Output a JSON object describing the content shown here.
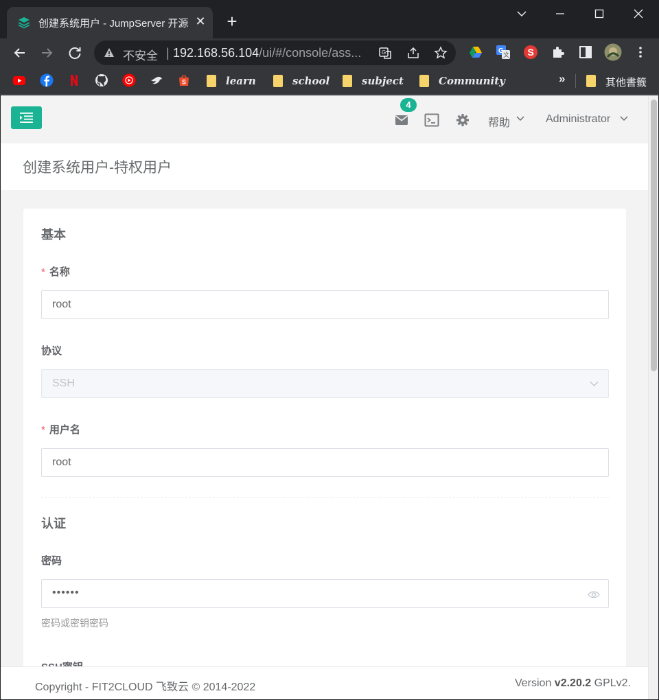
{
  "browser": {
    "tab_title": "创建系统用户 - JumpServer 开源",
    "close_glyph": "✕",
    "newtab_glyph": "+",
    "omnibox": {
      "security_label": "不安全",
      "separator": "|",
      "url_host": "192.168.56.104",
      "url_path": "/ui/#/console/ass..."
    },
    "bookmarks": [
      {
        "label": "learn"
      },
      {
        "label": "school"
      },
      {
        "label": "subject"
      },
      {
        "label": "Community"
      }
    ],
    "bookmarks_more": "»",
    "other_bookmarks": "其他書籤"
  },
  "app": {
    "accent_color": "#1ab394",
    "mail_badge_count": "4",
    "help_label": "帮助",
    "user_label": "Administrator",
    "page_title": "创建系统用户-特权用户"
  },
  "form": {
    "section_basic": "基本",
    "name_label": "名称",
    "name_value": "root",
    "protocol_label": "协议",
    "protocol_value": "SSH",
    "username_label": "用户名",
    "username_value": "root",
    "section_auth": "认证",
    "password_label": "密码",
    "password_value": "••••••",
    "password_help": "密码或密钥密码",
    "sshkey_label": "SSH密钥",
    "required_mark": "*"
  },
  "footer": {
    "copyright": "Copyright - FIT2CLOUD 飞致云 © 2014-2022",
    "version_prefix": "Version",
    "version_number": "v2.20.2",
    "license": "GPLv2."
  }
}
